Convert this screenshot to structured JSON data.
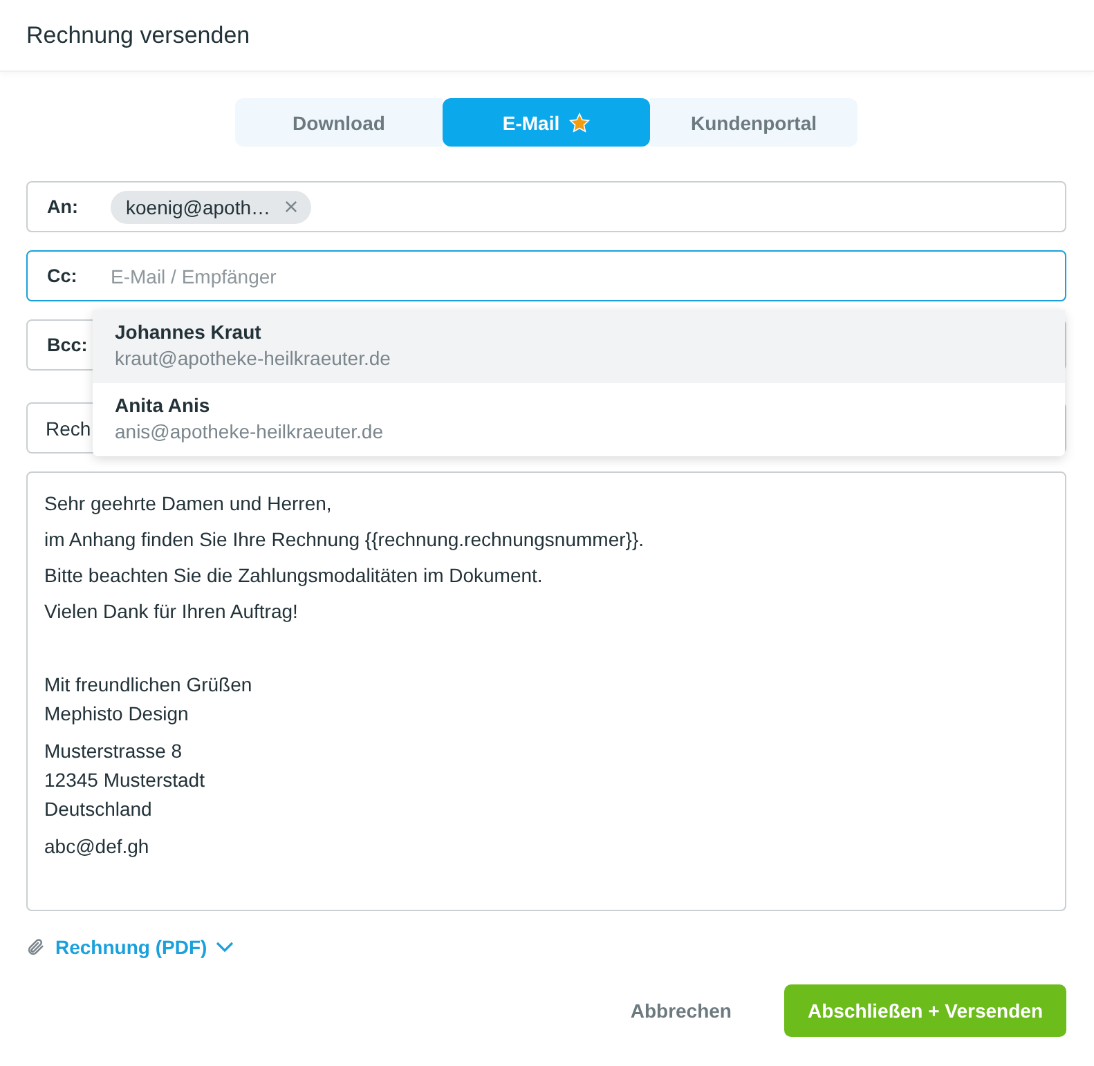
{
  "dialog": {
    "title": "Rechnung versenden"
  },
  "tabs": [
    {
      "label": "Download",
      "selected": false,
      "starred": false
    },
    {
      "label": "E-Mail",
      "selected": true,
      "starred": true
    },
    {
      "label": "Kundenportal",
      "selected": false,
      "starred": false
    }
  ],
  "fields": [
    {
      "label": "An:",
      "chips": [
        "koenig@apoth…"
      ],
      "focused": false
    },
    {
      "label": "Cc:",
      "placeholder": "E-Mail / Empfänger",
      "focused": true
    },
    {
      "label": "Bcc:",
      "focused": false
    }
  ],
  "subject": {
    "value": "Rech"
  },
  "suggestions": [
    {
      "name": "Johannes Kraut",
      "email": "kraut@apotheke-heilkraeuter.de",
      "selected": true
    },
    {
      "name": "Anita Anis",
      "email": "anis@apotheke-heilkraeuter.de",
      "selected": false
    }
  ],
  "body": [
    {
      "kind": "line",
      "lines": [
        "Sehr geehrte Damen und Herren,"
      ]
    },
    {
      "kind": "line",
      "lines": [
        "im Anhang finden Sie Ihre Rechnung {{rechnung.rechnungsnummer}}."
      ]
    },
    {
      "kind": "line",
      "lines": [
        "Bitte beachten Sie die Zahlungsmodalitäten im Dokument."
      ]
    },
    {
      "kind": "line",
      "lines": [
        "Vielen Dank für Ihren Auftrag!"
      ]
    },
    {
      "kind": "signature",
      "lines": [
        "Mit freundlichen Grüßen",
        "Mephisto Design"
      ]
    },
    {
      "kind": "block",
      "lines": [
        "Musterstrasse 8",
        "12345 Musterstadt",
        "Deutschland"
      ]
    },
    {
      "kind": "block",
      "lines": [
        "abc@def.gh"
      ]
    }
  ],
  "attachment": {
    "label": "Rechnung (PDF)"
  },
  "buttons": [
    {
      "label": "Abbrechen",
      "kind": "secondary"
    },
    {
      "label": "Abschließen + Versenden",
      "kind": "primary"
    }
  ]
}
